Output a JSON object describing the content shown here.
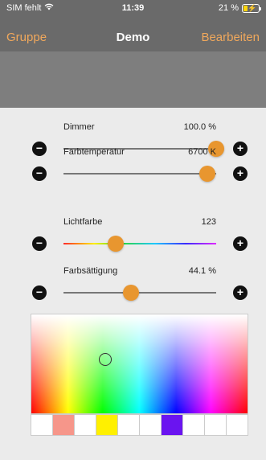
{
  "status": {
    "carrier": "SIM fehlt",
    "time": "11:39",
    "battery": "21 %"
  },
  "nav": {
    "back_label": "Gruppe",
    "title": "Demo",
    "edit_label": "Bearbeiten"
  },
  "sliders": [
    {
      "label": "Dimmer",
      "value": "100.0 %",
      "level": 1.0
    },
    {
      "label": "Farbtemperatur",
      "value": "6700 K",
      "level": 0.94
    },
    {
      "label": "Lichtfarbe",
      "value": "123",
      "level": 0.34
    },
    {
      "label": "Farbsättigung",
      "value": "44.1 %",
      "level": 0.44
    }
  ],
  "controls": {
    "minus_glyph": "−",
    "plus_glyph": "+"
  },
  "swatch_colors": [
    "#ffffff",
    "#f6968a",
    "#ffffff",
    "#fff000",
    "#ffffff",
    "#ffffff",
    "#6a14f0",
    "#ffffff",
    "#ffffff",
    "#ffffff"
  ],
  "colors": {
    "accent": "#e8962f",
    "nav_text": "#f0a85c",
    "topbar": "#6a6a6a",
    "banner": "#7e7e7e",
    "background": "#ebebeb"
  }
}
